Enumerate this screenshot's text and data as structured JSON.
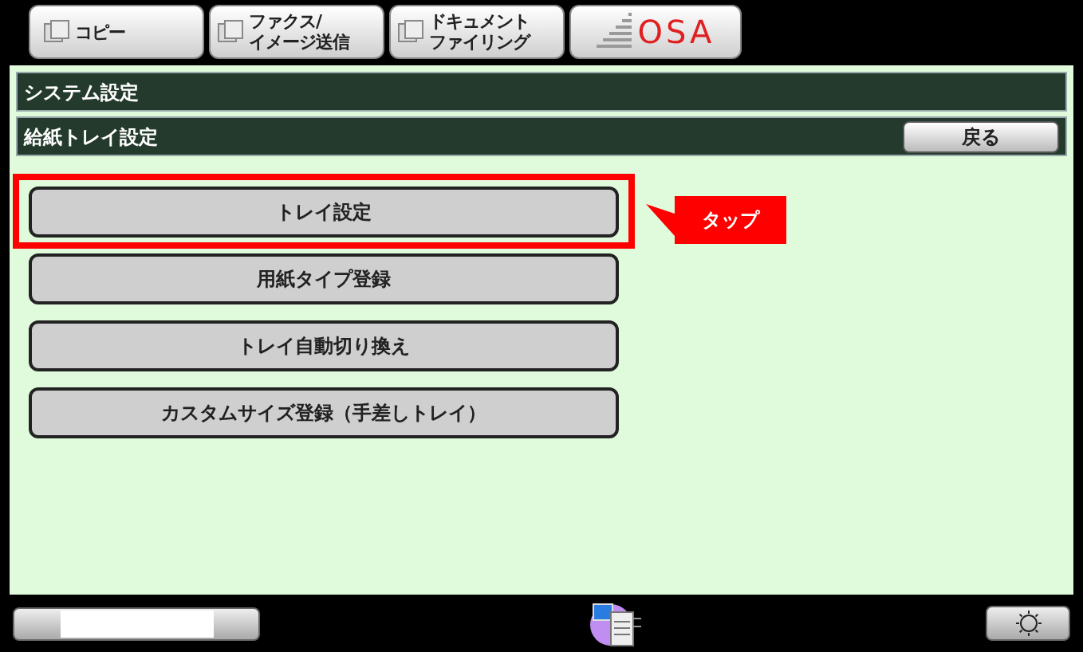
{
  "tabs": [
    {
      "kind": "copy",
      "lines": [
        "コピー"
      ]
    },
    {
      "kind": "fax",
      "lines": [
        "ファクス/",
        "イメージ送信"
      ]
    },
    {
      "kind": "document",
      "lines": [
        "ドキュメント",
        "ファイリング"
      ]
    },
    {
      "kind": "logo",
      "lines": [
        "OSA"
      ]
    }
  ],
  "breadcrumb": [
    "システム設定",
    "給紙トレイ設定"
  ],
  "back_button": "戻る",
  "menu": [
    {
      "label": "トレイ設定",
      "highlighted": true
    },
    {
      "label": "用紙タイプ登録",
      "highlighted": false
    },
    {
      "label": "トレイ自動切り換え",
      "highlighted": false
    },
    {
      "label": "カスタムサイズ登録（手差しトレイ）",
      "highlighted": false
    }
  ],
  "callout": "タップ"
}
